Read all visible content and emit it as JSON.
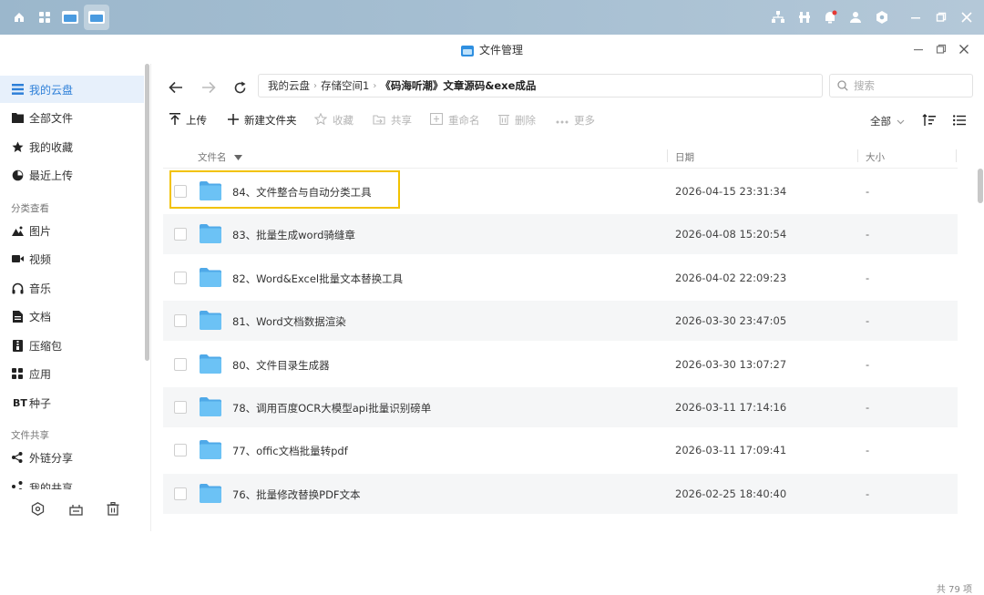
{
  "window": {
    "title": "文件管理"
  },
  "sidebar": {
    "items_top": [
      {
        "label": "我的云盘",
        "icon": "list-icon",
        "active": true
      },
      {
        "label": "全部文件",
        "icon": "folder-icon"
      },
      {
        "label": "我的收藏",
        "icon": "star-icon"
      },
      {
        "label": "最近上传",
        "icon": "pie-clock-icon"
      }
    ],
    "section_category": "分类查看",
    "items_category": [
      {
        "label": "图片",
        "icon": "mountain-image-icon"
      },
      {
        "label": "视频",
        "icon": "video-icon"
      },
      {
        "label": "音乐",
        "icon": "headphones-icon"
      },
      {
        "label": "文档",
        "icon": "document-icon"
      },
      {
        "label": "压缩包",
        "icon": "archive-icon"
      },
      {
        "label": "应用",
        "icon": "apps-grid-icon"
      },
      {
        "label": "种子",
        "icon": "bt-icon",
        "icon_text": "BT"
      }
    ],
    "section_share": "文件共享",
    "items_share": [
      {
        "label": "外链分享",
        "icon": "share-icon"
      },
      {
        "label": "我的共享",
        "icon": "shared-icon"
      }
    ]
  },
  "breadcrumb": [
    "我的云盘",
    "存储空间1",
    "《码海听潮》文章源码&exe成品"
  ],
  "search": {
    "placeholder": "搜索"
  },
  "toolbar": {
    "upload": "上传",
    "new_folder": "新建文件夹",
    "favorite": "收藏",
    "share": "共享",
    "rename": "重命名",
    "delete": "删除",
    "more": "更多",
    "filter": "全部"
  },
  "columns": {
    "name": "文件名",
    "date": "日期",
    "size": "大小"
  },
  "files": [
    {
      "name": "84、文件整合与自动分类工具",
      "date": "2026-04-15 23:31:34",
      "size": "-"
    },
    {
      "name": "83、批量生成word骑缝章",
      "date": "2026-04-08 15:20:54",
      "size": "-"
    },
    {
      "name": "82、Word&Excel批量文本替换工具",
      "date": "2026-04-02 22:09:23",
      "size": "-"
    },
    {
      "name": "81、Word文档数据渲染",
      "date": "2026-03-30 23:47:05",
      "size": "-"
    },
    {
      "name": "80、文件目录生成器",
      "date": "2026-03-30 13:07:27",
      "size": "-"
    },
    {
      "name": "78、调用百度OCR大模型api批量识别磅单",
      "date": "2026-03-11 17:14:16",
      "size": "-"
    },
    {
      "name": "77、offic文档批量转pdf",
      "date": "2026-03-11 17:09:41",
      "size": "-"
    },
    {
      "name": "76、批量修改替换PDF文本",
      "date": "2026-02-25 18:40:40",
      "size": "-"
    }
  ],
  "footer": {
    "total": "共 79 项"
  },
  "colors": {
    "accent": "#2d7fd8",
    "folder": "#5bb8f0",
    "highlight": "#f2c200",
    "topbar": "#a6bfd2"
  }
}
